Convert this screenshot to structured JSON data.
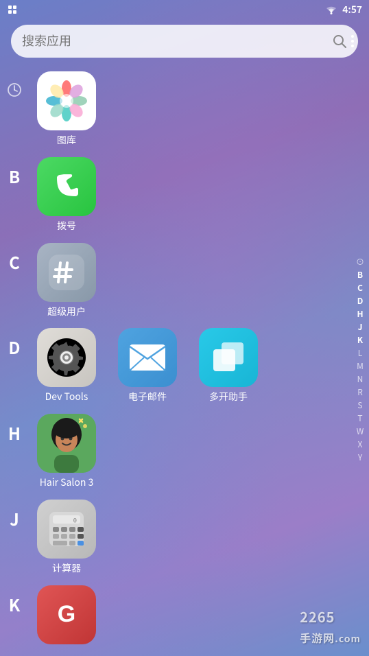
{
  "statusBar": {
    "time": "4:57",
    "wifiLabel": "wifi"
  },
  "searchBar": {
    "placeholder": "搜索应用",
    "moreLabel": "⋮"
  },
  "alphabetIndex": {
    "letters": [
      "⊙",
      "B",
      "C",
      "D",
      "H",
      "J",
      "K",
      "L",
      "M",
      "N",
      "R",
      "S",
      "T",
      "W",
      "X",
      "Y"
    ]
  },
  "sections": [
    {
      "letter": "",
      "isRecent": true,
      "apps": []
    },
    {
      "letter": "B",
      "apps": [
        {
          "id": "phone",
          "label": "拨号",
          "iconType": "phone"
        }
      ]
    },
    {
      "letter": "C",
      "apps": [
        {
          "id": "superuser",
          "label": "超级用户",
          "iconType": "superuser"
        }
      ]
    },
    {
      "letter": "D",
      "apps": [
        {
          "id": "devtools",
          "label": "Dev Tools",
          "iconType": "devtools"
        },
        {
          "id": "mail",
          "label": "电子邮件",
          "iconType": "mail"
        },
        {
          "id": "multiopen",
          "label": "多开助手",
          "iconType": "multiopen"
        }
      ]
    },
    {
      "letter": "H",
      "apps": [
        {
          "id": "hairsalon",
          "label": "Hair Salon 3",
          "iconType": "hairsalon"
        }
      ]
    },
    {
      "letter": "J",
      "apps": [
        {
          "id": "calculator",
          "label": "计算器",
          "iconType": "calc"
        }
      ]
    },
    {
      "letter": "K",
      "apps": [
        {
          "id": "gapp",
          "label": "",
          "iconType": "g"
        }
      ]
    }
  ],
  "watermark": {
    "line1": "2265",
    "line2": "手游网",
    "dot": ".com"
  }
}
